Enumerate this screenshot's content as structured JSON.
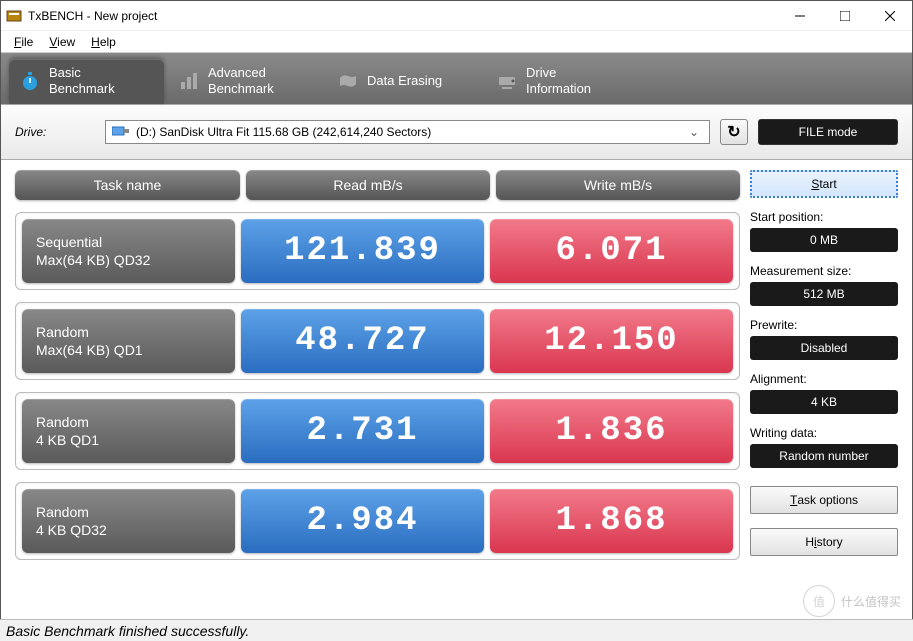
{
  "window": {
    "title": "TxBENCH - New project"
  },
  "menu": {
    "file": "File",
    "view": "View",
    "help": "Help"
  },
  "tabs": {
    "basic": "Basic\nBenchmark",
    "advanced": "Advanced\nBenchmark",
    "erasing": "Data Erasing",
    "drive_info": "Drive\nInformation"
  },
  "drive": {
    "label": "Drive:",
    "selected": "(D:) SanDisk Ultra Fit  115.68 GB (242,614,240 Sectors)"
  },
  "buttons": {
    "file_mode": "FILE mode",
    "start": "Start",
    "task_options": "Task options",
    "history": "History"
  },
  "headers": {
    "task": "Task name",
    "read": "Read mB/s",
    "write": "Write mB/s"
  },
  "results": [
    {
      "task_line1": "Sequential",
      "task_line2": "Max(64 KB) QD32",
      "read": "121.839",
      "write": "6.071"
    },
    {
      "task_line1": "Random",
      "task_line2": "Max(64 KB) QD1",
      "read": "48.727",
      "write": "12.150"
    },
    {
      "task_line1": "Random",
      "task_line2": "4 KB QD1",
      "read": "2.731",
      "write": "1.836"
    },
    {
      "task_line1": "Random",
      "task_line2": "4 KB QD32",
      "read": "2.984",
      "write": "1.868"
    }
  ],
  "side": {
    "start_position_label": "Start position:",
    "start_position_value": "0 MB",
    "measurement_size_label": "Measurement size:",
    "measurement_size_value": "512 MB",
    "prewrite_label": "Prewrite:",
    "prewrite_value": "Disabled",
    "alignment_label": "Alignment:",
    "alignment_value": "4 KB",
    "writing_data_label": "Writing data:",
    "writing_data_value": "Random number"
  },
  "status": "Basic Benchmark finished successfully.",
  "watermark": {
    "badge": "值",
    "text": "什么值得买"
  }
}
